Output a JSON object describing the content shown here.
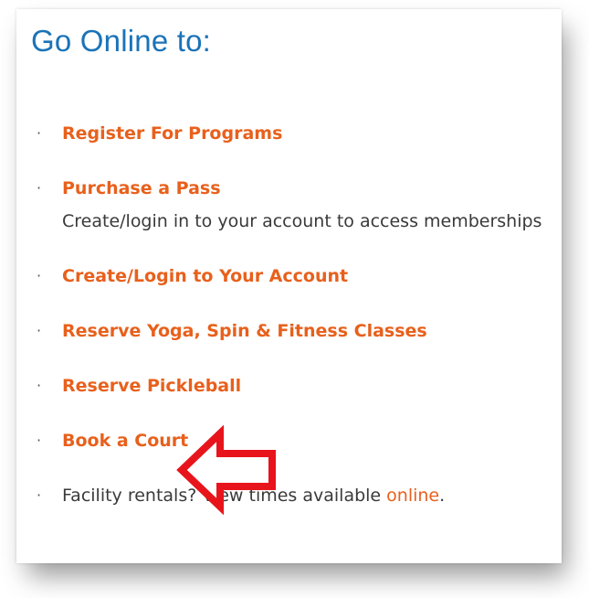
{
  "panel": {
    "title": "Go Online to:",
    "bullet_glyph": "·",
    "items": [
      {
        "label": "Register For Programs"
      },
      {
        "label": "Purchase a Pass",
        "description": "Create/login in to your account to access memberships"
      },
      {
        "label": "Create/Login to Your Account"
      },
      {
        "label": "Reserve Yoga, Spin & Fitness Classes"
      },
      {
        "label": "Reserve Pickleball"
      },
      {
        "label": "Book a Court"
      }
    ],
    "footer": {
      "text": "Facility rentals? View times available ",
      "link": "online",
      "suffix": "."
    }
  },
  "colors": {
    "title": "#1a73b8",
    "link": "#e8601c",
    "arrow": "#e8141c"
  },
  "annotation": {
    "type": "arrow-pointing-left",
    "icon": "red-outline-arrow-icon",
    "target_item": "Book a Court"
  }
}
